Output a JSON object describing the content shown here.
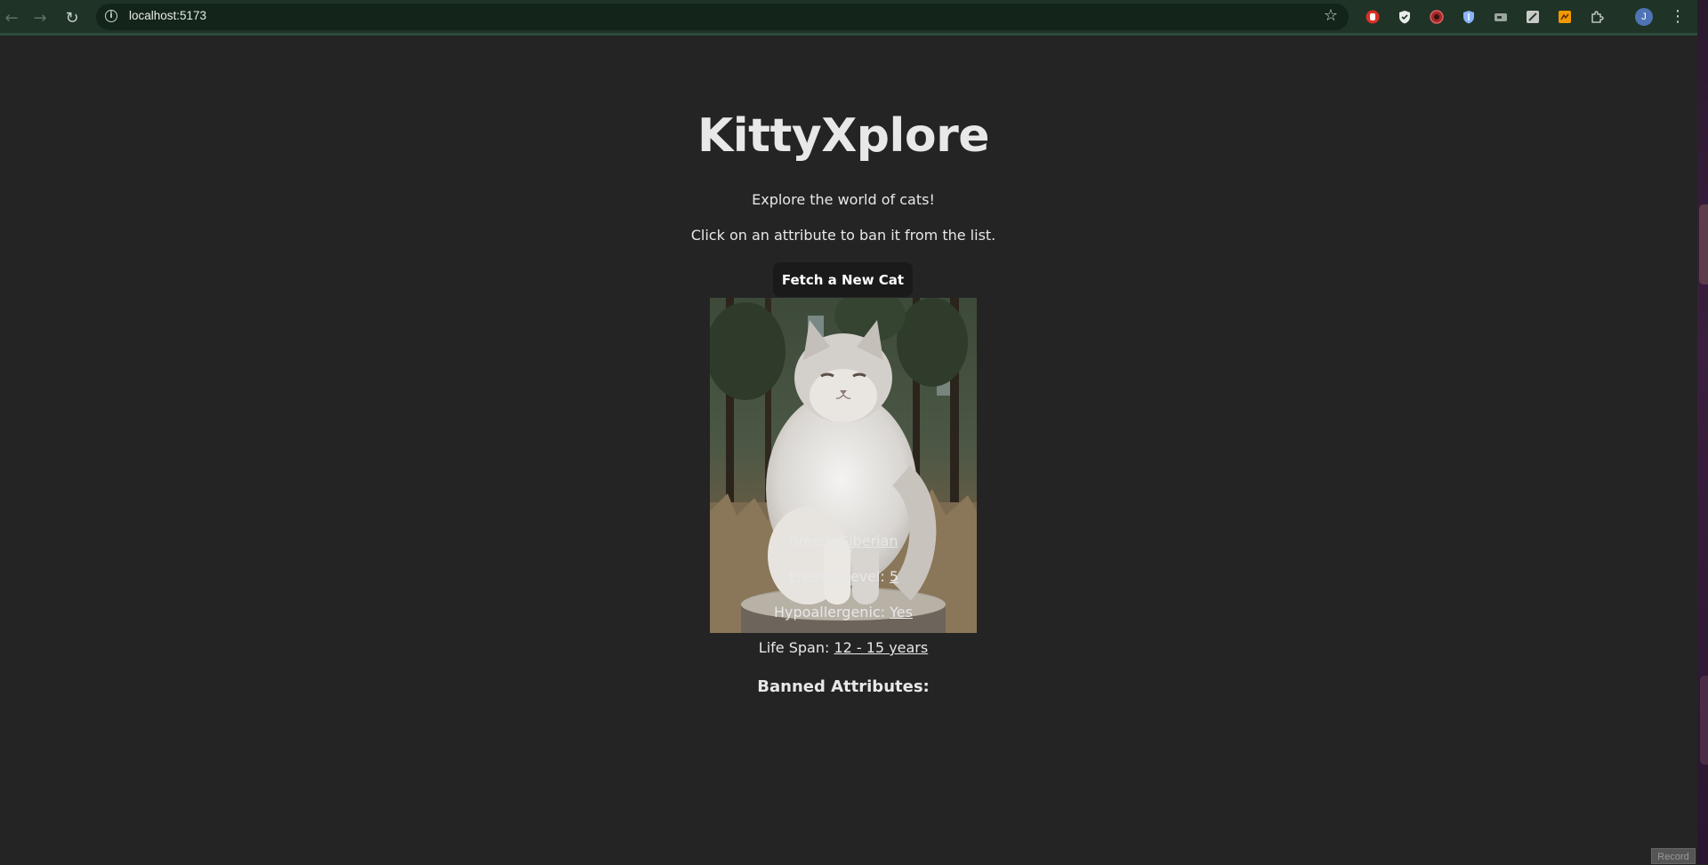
{
  "browser": {
    "url": "localhost:5173",
    "avatar_initial": "J"
  },
  "app": {
    "title": "KittyXplore",
    "subtitle": "Explore the world of cats!",
    "instruction": "Click on an attribute to ban it from the list.",
    "fetch_button": "Fetch a New Cat",
    "image_alt": "Siberian cat sitting on a tree stump"
  },
  "attributes": [
    {
      "label": "Breed: ",
      "value": "Siberian"
    },
    {
      "label": "Energy Level: ",
      "value": "5"
    },
    {
      "label": "Hypoallergenic: ",
      "value": "Yes"
    },
    {
      "label": "Life Span: ",
      "value": "12 - 15 years"
    }
  ],
  "banned_heading": "Banned Attributes:",
  "overlay": {
    "record_label": "Record"
  },
  "icons": {
    "back": "arrow-left-icon",
    "forward": "arrow-right-icon",
    "reload": "reload-icon",
    "site_info": "info-icon",
    "bookmark": "star-icon",
    "extensions": "puzzle-icon",
    "menu": "kebab-menu-icon"
  },
  "colors": {
    "page_background": "#242424",
    "button_background": "#1a1a1a",
    "chrome_background": "#1f3327",
    "text": "#e8e8e8"
  }
}
